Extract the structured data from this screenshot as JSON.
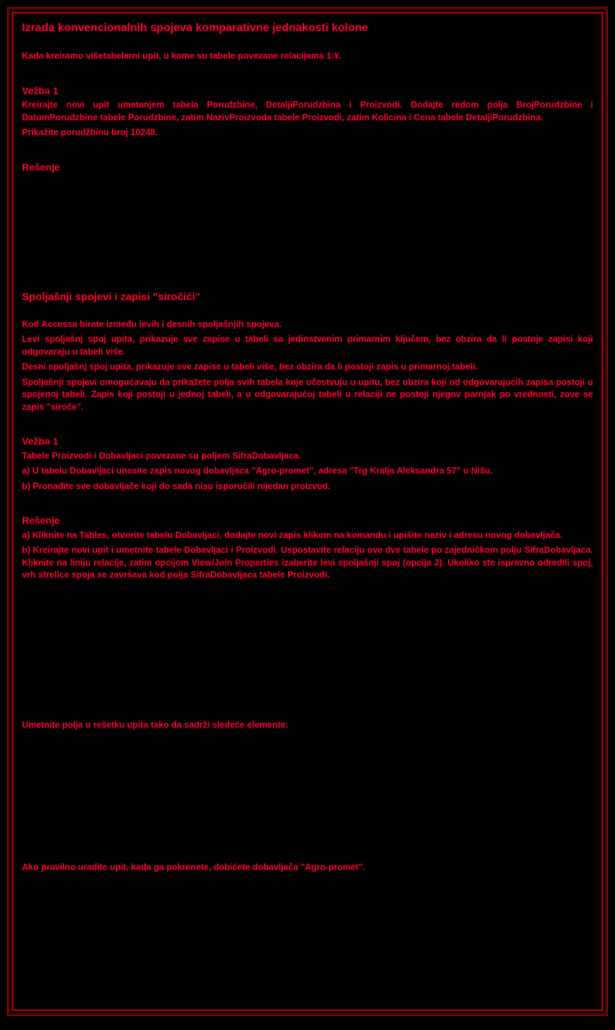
{
  "section1": {
    "title": "Izrada konvencionalnih spojeva komparativne jednakosti kolone",
    "intro": "Kada kreiramo višetabelarni upit, u kome su tabele povezane relacijama 1:¥.",
    "vezba_label": "Vežba 1",
    "vezba_text": "Kreirajte novi upit umetanjem tabela Porudzbine, DetaljiPorudzbina i Proizvodi. Dodajte redom polja BrojPorudzbine i DatumPorudzbine tabele Porudzbine, zatim NazivProizvoda tabele Proizvodi, zatim Kolicina i Cena tabele DetaljiPorudzbina.",
    "vezba_instruction": "Prikažite porudžbinu broj 10248.",
    "resenje_label": "Rešenje"
  },
  "section2": {
    "title": "Spoljašnji spojevi i zapisi \"siročići\"",
    "para1": "Kod Accessa birate između levih i desnih spoljašnjih spojeva.",
    "para2": "Levi spoljašnj spoj upita, prikazuje sve zapise u tabeli sa jedinstvenim primarnim ključem, bez obzira da li postoje zapisi koji odgovaraju u tabeli više.",
    "para3": "Desni spoljašnj spoj upita, prikazuje sve zapise u tabeli više, bez obzira da li postoji zapis u primarnoj tabeli.",
    "para4": "Spoljašnji spojevi omogućavaju da prikažete polja svih tabela koje učestvuju u upitu, bez obzira koji od odgovarajućih zapisa postoji u spojenoj tabeli.  Zapis koji postoji u jednoj tabeli, a u odgovarajućoj tabeli u relaciji ne postoji njegov parnjak po vrednosti, zove se zapis \"siroče\".",
    "vezba_label": "Vežba 1",
    "vezba_line1": "Tabele Proizvodi i Dobavljaci povezane su poljem SifraDobavljaca.",
    "vezba_line2": "a) U tabelu Dobavljaci unesite zapis novog dobavljaca \"Agro-promet\", adresa \"Trg Kralja Aleksandra 57\" u Nišu.",
    "vezba_line3": "b) Pronađite sve dobavljače koji do sada nisu isporučili nijedan proizvod.",
    "resenje_label": "Rešenje",
    "resenje_a": "a) Kliknite na Tables, otvorite tabelu Dobavljaci, dodajte novi zapis klikom na komandu       i upišite naziv i adresu novog dobavljača.",
    "resenje_b": "b) Kreirajte novi upit i umetnite tabele Dobavljaci i Proizvodi. Uspostavite relaciju ove dve tabele po zajedničkom polju SifraDobavljaca. Kliknite na liniju relacije, zatim opcijom View/Join Properties izaberite levi spoljašnji spoj (opcija 2). Ukoliko ste ispravno odredili spoj, vrh strelice spoja se završava kod polja SifraDobavljaca tabele Proizvodi."
  },
  "section3": {
    "insert_text": "Umetnite polja u rešetku upita tako da sadrži sledeće elemente:",
    "final_text": "Ako pravilno uradite upit, kada ga pokrenete, dobićete dobavljača \"Agro-promet\"."
  }
}
